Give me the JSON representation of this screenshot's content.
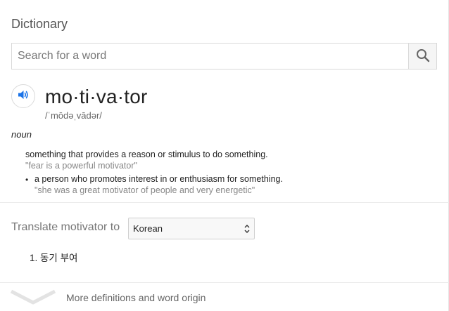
{
  "header": {
    "title": "Dictionary"
  },
  "search": {
    "placeholder": "Search for a word",
    "value": ""
  },
  "entry": {
    "word": "mo·ti·va·tor",
    "phonetic": "/ˈmōdəˌvādər/",
    "part_of_speech": "noun",
    "definitions": [
      {
        "text": "something that provides a reason or stimulus to do something.",
        "example": "\"fear is a powerful motivator\""
      },
      {
        "text": "a person who promotes interest in or enthusiasm for something.",
        "example": "\"she was a great motivator of people and very energetic\""
      }
    ],
    "bullet": "•"
  },
  "translate": {
    "label": "Translate motivator to",
    "selected_language": "Korean",
    "results": [
      "1. 동기 부여"
    ]
  },
  "footer": {
    "more_label": "More definitions and word origin"
  },
  "icons": {
    "search": "search-icon",
    "speaker": "speaker-icon",
    "chevron": "chevron-down-icon",
    "select_arrows": "select-arrows-icon"
  },
  "colors": {
    "accent": "#1a73e8",
    "example_text": "#878787"
  }
}
